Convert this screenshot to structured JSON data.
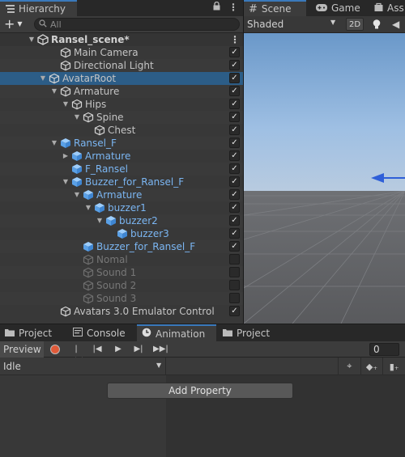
{
  "hierarchy": {
    "tab_label": "Hierarchy",
    "search_placeholder": "All",
    "rows": [
      {
        "label": "Ransel_scene*",
        "type": "scene",
        "indent": 0,
        "arrow": "down"
      },
      {
        "label": "Main Camera",
        "type": "object",
        "indent": 2,
        "arrow": "",
        "checked": true
      },
      {
        "label": "Directional Light",
        "type": "object",
        "indent": 2,
        "arrow": "",
        "checked": true
      },
      {
        "label": "AvatarRoot",
        "type": "object",
        "indent": 1,
        "arrow": "down",
        "checked": true,
        "selected": true
      },
      {
        "label": "Armature",
        "type": "object",
        "indent": 2,
        "arrow": "down",
        "checked": true
      },
      {
        "label": "Hips",
        "type": "object",
        "indent": 3,
        "arrow": "down",
        "checked": true
      },
      {
        "label": "Spine",
        "type": "object",
        "indent": 4,
        "arrow": "down",
        "checked": true
      },
      {
        "label": "Chest",
        "type": "object",
        "indent": 5,
        "arrow": "",
        "checked": true
      },
      {
        "label": "Ransel_F",
        "type": "prefab",
        "indent": 2,
        "arrow": "down",
        "checked": true
      },
      {
        "label": "Armature",
        "type": "prefab",
        "indent": 3,
        "arrow": "right",
        "checked": true
      },
      {
        "label": "F_Ransel",
        "type": "prefab",
        "indent": 3,
        "arrow": "",
        "checked": true
      },
      {
        "label": "Buzzer_for_Ransel_F",
        "type": "prefab",
        "indent": 3,
        "arrow": "down",
        "checked": true
      },
      {
        "label": "Armature",
        "type": "prefab",
        "indent": 4,
        "arrow": "down",
        "checked": true
      },
      {
        "label": "buzzer1",
        "type": "prefab",
        "indent": 5,
        "arrow": "down",
        "checked": true
      },
      {
        "label": "buzzer2",
        "type": "prefab",
        "indent": 6,
        "arrow": "down",
        "checked": true
      },
      {
        "label": "buzzer3",
        "type": "prefab",
        "indent": 7,
        "arrow": "",
        "checked": true
      },
      {
        "label": "Buzzer_for_Ransel_F",
        "type": "prefab",
        "indent": 4,
        "arrow": "",
        "checked": true
      },
      {
        "label": "Nomal",
        "type": "disabled",
        "indent": 4,
        "arrow": "",
        "checked": false
      },
      {
        "label": "Sound 1",
        "type": "disabled",
        "indent": 4,
        "arrow": "",
        "checked": false
      },
      {
        "label": "Sound 2",
        "type": "disabled",
        "indent": 4,
        "arrow": "",
        "checked": false
      },
      {
        "label": "Sound 3",
        "type": "disabled",
        "indent": 4,
        "arrow": "",
        "checked": false
      },
      {
        "label": "Avatars 3.0 Emulator Control",
        "type": "object",
        "indent": 2,
        "arrow": "",
        "checked": true
      }
    ]
  },
  "scene": {
    "tabs": [
      "Scene",
      "Game",
      "Ass"
    ],
    "shading_mode": "Shaded",
    "mode_2d": "2D"
  },
  "animation": {
    "tabs": [
      "Project",
      "Console",
      "Animation",
      "Project"
    ],
    "preview_label": "Preview",
    "frame_value": "0",
    "clip_name": "Idle",
    "add_property_label": "Add Property"
  },
  "colors": {
    "selection": "#2c5d87",
    "prefab_text": "#7bb6f3",
    "record": "#e05a39",
    "active_tab_accent": "#3a79bb"
  }
}
